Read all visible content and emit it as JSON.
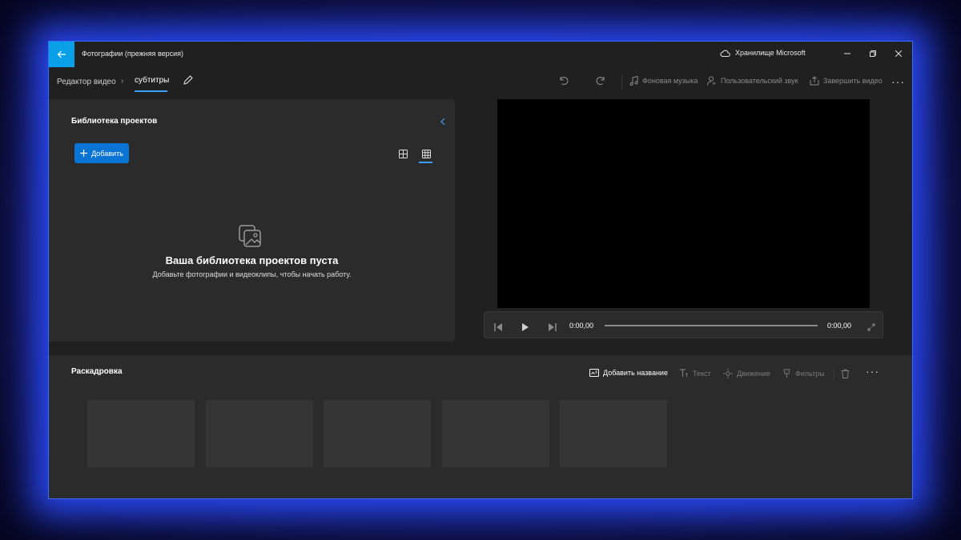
{
  "window": {
    "app_title": "Фотографии (прежняя версия)",
    "storage_label": "Хранилище Microsoft"
  },
  "breadcrumb": {
    "parent": "Редактор видео",
    "current": "субтитры"
  },
  "toolbar": {
    "background_music": "Фоновая музыка",
    "custom_audio": "Пользовательский звук",
    "finish_video": "Завершить видео"
  },
  "library": {
    "title": "Библиотека проектов",
    "add_label": "Добавить",
    "empty_title": "Ваша библиотека проектов пуста",
    "empty_subtitle": "Добавьте фотографии и видеоклипы, чтобы начать работу."
  },
  "player": {
    "current_time": "0:00,00",
    "total_time": "0:00,00",
    "progress": 0
  },
  "storyboard": {
    "title": "Раскадровка",
    "add_title": "Добавить название",
    "text": "Текст",
    "motion": "Движение",
    "filters": "Фильтры",
    "tile_count": 5
  },
  "colors": {
    "accent": "#0a74d4",
    "back_button": "#0aa0e8",
    "window_bg": "#202020",
    "panel_bg": "#2b2b2b",
    "glow": "#2a4cff"
  },
  "icons": [
    "back-arrow-icon",
    "cloud-icon",
    "minimize-icon",
    "maximize-icon",
    "close-icon",
    "pencil-icon",
    "undo-icon",
    "redo-icon",
    "music-icon",
    "person-audio-icon",
    "share-icon",
    "more-icon",
    "chevron-left-icon",
    "plus-icon",
    "grid-small-icon",
    "grid-large-icon",
    "photos-stack-icon",
    "skip-back-icon",
    "play-icon",
    "skip-forward-icon",
    "fullscreen-icon",
    "title-card-icon",
    "text-icon",
    "motion-icon",
    "filters-icon",
    "trash-icon"
  ]
}
